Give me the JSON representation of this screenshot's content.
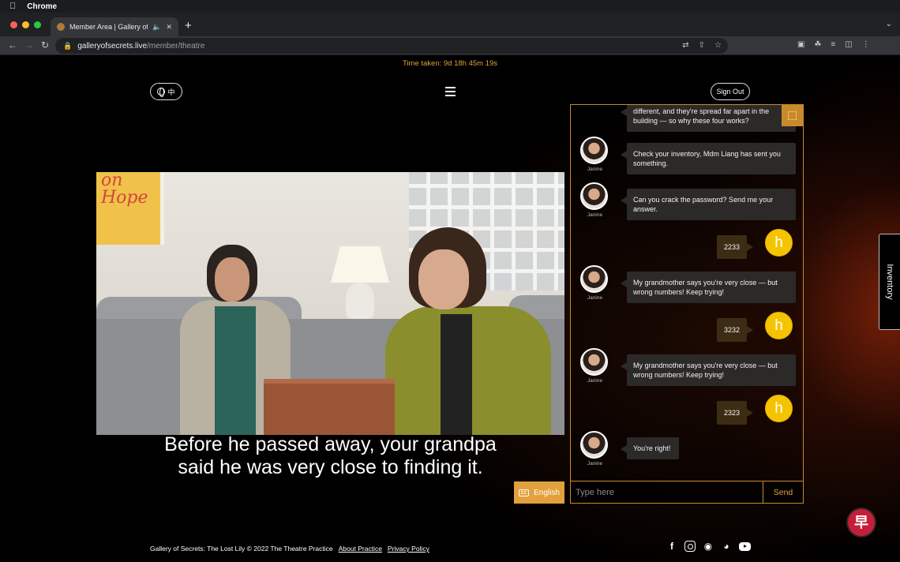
{
  "os": {
    "apple_icon": "apple-icon",
    "app_name": "Chrome"
  },
  "browser": {
    "tab_title": "Member Area | Gallery of S",
    "new_tab": "+",
    "url_host": "galleryofsecrets.live",
    "url_path": "/member/theatre"
  },
  "page": {
    "timer": "Time taken: 9d 18h 45m 19s",
    "lang_button": "中",
    "signout": "Sign Out",
    "subtitle_line1": "Before he passed away, your grandpa",
    "subtitle_line2": "said he was very close to finding it.",
    "cc_badge": "CC",
    "cc_label": "English",
    "inventory": "Inventory",
    "chat_placeholder": "Type here",
    "send": "Send",
    "footer_copyright": "Gallery of Secrets: The Lost Lily © 2022 The Theatre Practice",
    "footer_about": "About Practice",
    "footer_privacy": "Privacy Policy",
    "badge_glyph": "早",
    "accent_color": "#e2a13d"
  },
  "chat": {
    "agent_name": "Janine",
    "user_initial": "h",
    "messages": [
      {
        "from": "agent",
        "text": "different, and they're spread far apart in the building — so why these four works?"
      },
      {
        "from": "agent",
        "text": "Check your inventory, Mdm Liang has sent you something."
      },
      {
        "from": "agent",
        "text": "Can you crack the password? Send me your answer."
      },
      {
        "from": "user",
        "text": "2233"
      },
      {
        "from": "agent",
        "text": "My grandmother says you're very close — but wrong numbers! Keep trying!"
      },
      {
        "from": "user",
        "text": "3232"
      },
      {
        "from": "agent",
        "text": "My grandmother says you're very close — but wrong numbers! Keep trying!"
      },
      {
        "from": "user",
        "text": "2323"
      },
      {
        "from": "agent",
        "text": "You're right!"
      }
    ]
  },
  "social_icons": [
    "facebook-icon",
    "instagram-icon",
    "wechat-icon",
    "weibo-icon",
    "youtube-icon"
  ]
}
